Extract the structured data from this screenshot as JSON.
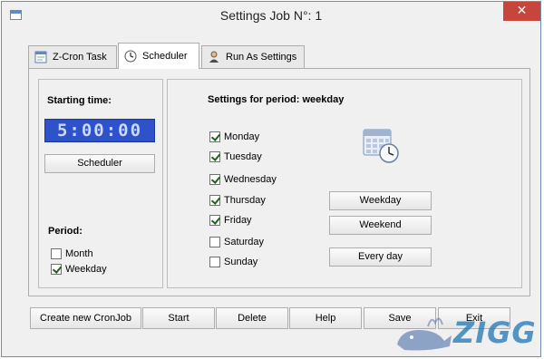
{
  "window": {
    "title": "Settings Job N°: 1",
    "close_symbol": "✕"
  },
  "tabs": [
    {
      "label": "Z-Cron Task",
      "icon": "task-icon"
    },
    {
      "label": "Scheduler",
      "icon": "clock-icon",
      "active": true
    },
    {
      "label": "Run As Settings",
      "icon": "user-icon"
    }
  ],
  "scheduler": {
    "starting_time_label": "Starting time:",
    "time_value": "5:00:00",
    "scheduler_button": "Scheduler",
    "period_label": "Period:",
    "period_options": [
      {
        "label": "Month",
        "checked": false
      },
      {
        "label": "Weekday",
        "checked": true
      }
    ]
  },
  "period_settings": {
    "heading": "Settings for period: weekday",
    "days": [
      {
        "label": "Monday",
        "checked": true
      },
      {
        "label": "Tuesday",
        "checked": true
      },
      {
        "label": "Wednesday",
        "checked": true
      },
      {
        "label": "Thursday",
        "checked": true
      },
      {
        "label": "Friday",
        "checked": true
      },
      {
        "label": "Saturday",
        "checked": false
      },
      {
        "label": "Sunday",
        "checked": false
      }
    ],
    "preset_buttons": {
      "weekday": "Weekday",
      "weekend": "Weekend",
      "every_day": "Every day"
    },
    "icon": "calendar-clock-icon"
  },
  "footer": {
    "create": "Create new CronJob",
    "start": "Start",
    "delete": "Delete",
    "help": "Help",
    "save": "Save",
    "exit": "Exit"
  },
  "watermark": {
    "text": "ZIGG",
    "icon": "whale-logo"
  },
  "colors": {
    "lcd_background": "#2d52c9",
    "close_button": "#c7453a",
    "checkmark": "#1f5f1f",
    "watermark": "#1e77b6"
  }
}
